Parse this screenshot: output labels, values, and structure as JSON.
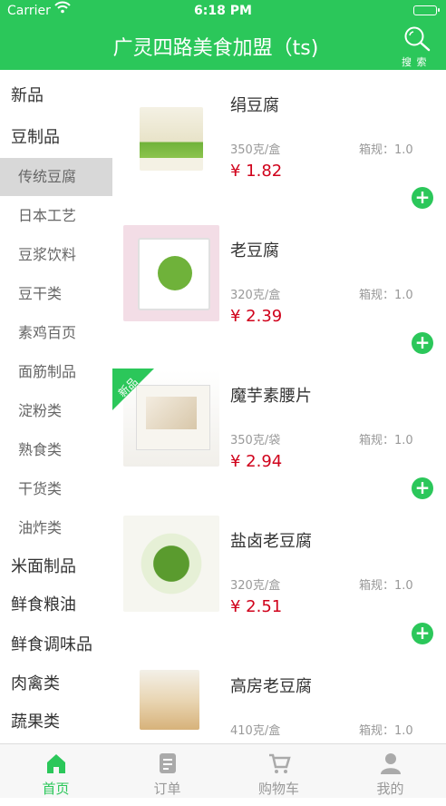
{
  "status_bar": {
    "carrier": "Carrier",
    "time": "6:18 PM"
  },
  "header": {
    "title": "广灵四路美食加盟（ts)",
    "search_label": "搜 索"
  },
  "sidebar": {
    "categories": [
      {
        "label": "新品",
        "level": "main"
      },
      {
        "label": "豆制品",
        "level": "main"
      },
      {
        "label": "传统豆腐",
        "level": "sub",
        "active": true
      },
      {
        "label": "日本工艺",
        "level": "sub"
      },
      {
        "label": "豆浆饮料",
        "level": "sub"
      },
      {
        "label": "豆干类",
        "level": "sub"
      },
      {
        "label": "素鸡百页",
        "level": "sub"
      },
      {
        "label": "面筋制品",
        "level": "sub"
      },
      {
        "label": "淀粉类",
        "level": "sub"
      },
      {
        "label": "熟食类",
        "level": "sub"
      },
      {
        "label": "干货类",
        "level": "sub"
      },
      {
        "label": "油炸类",
        "level": "sub"
      },
      {
        "label": "米面制品",
        "level": "main"
      },
      {
        "label": "鲜食粮油",
        "level": "main"
      },
      {
        "label": "鲜食调味品",
        "level": "main"
      },
      {
        "label": "肉禽类",
        "level": "main"
      },
      {
        "label": "蔬果类",
        "level": "main"
      }
    ]
  },
  "products": [
    {
      "name": "绢豆腐",
      "spec": "350克/盒",
      "rule": "箱规：1.0",
      "price": "¥ 1.82"
    },
    {
      "name": "老豆腐",
      "spec": "320克/盒",
      "rule": "箱规：1.0",
      "price": "¥ 2.39"
    },
    {
      "name": "魔芋素腰片",
      "spec": "350克/袋",
      "rule": "箱规：1.0",
      "price": "¥ 2.94",
      "tag": "新品"
    },
    {
      "name": "盐卤老豆腐",
      "spec": "320克/盒",
      "rule": "箱规：1.0",
      "price": "¥ 2.51"
    },
    {
      "name": "高房老豆腐",
      "spec": "410克/盒",
      "rule": "箱规：1.0",
      "price": ""
    }
  ],
  "add_symbol": "+",
  "tabbar": {
    "tabs": [
      {
        "label": "首页",
        "icon": "home-icon",
        "active": true
      },
      {
        "label": "订单",
        "icon": "order-icon"
      },
      {
        "label": "购物车",
        "icon": "cart-icon"
      },
      {
        "label": "我的",
        "icon": "user-icon"
      }
    ]
  },
  "colors": {
    "accent": "#2bc75a",
    "price": "#d0021b"
  }
}
